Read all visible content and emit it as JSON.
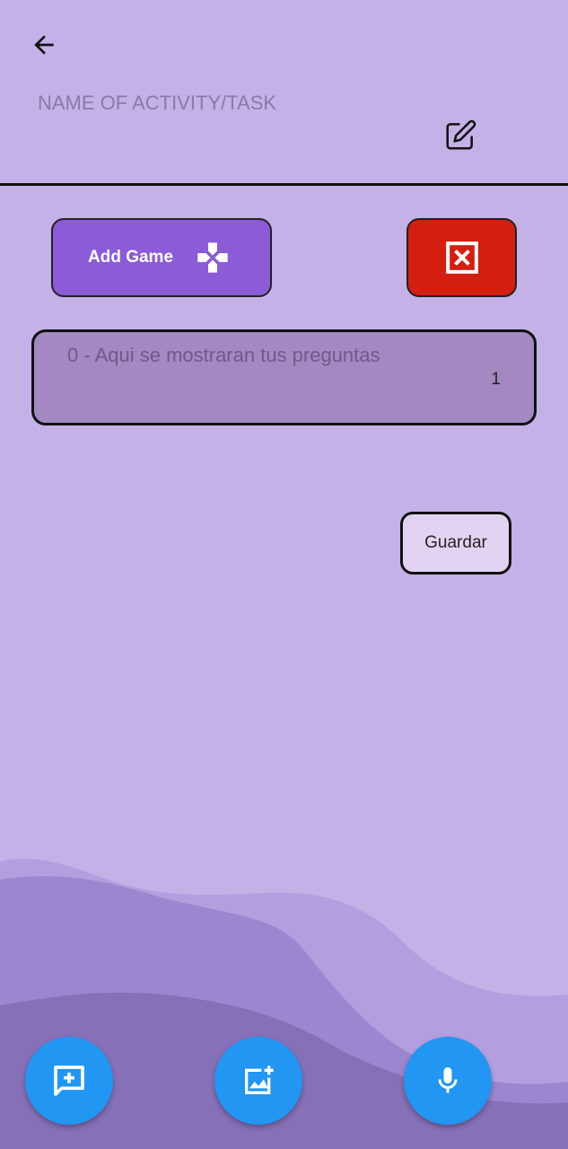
{
  "header": {
    "back_icon": "arrow-back-icon",
    "title_placeholder": "NAME OF ACTIVITY/TASK",
    "edit_icon": "edit-icon"
  },
  "actions": {
    "add_game_label": "Add Game",
    "add_game_icon": "gamepad-icon",
    "close_icon": "close-box-icon"
  },
  "question": {
    "text": "0 - Aqui se mostraran tus preguntas",
    "count": "1"
  },
  "save_label": "Guardar",
  "fabs": [
    {
      "icon": "add-comment-icon"
    },
    {
      "icon": "add-photo-icon"
    },
    {
      "icon": "mic-icon"
    }
  ],
  "colors": {
    "background": "#c3b1e8",
    "add_game": "#8b5bd8",
    "close": "#d31e10",
    "question_box": "#a388c2",
    "save": "#e3d3f2",
    "fab": "#2196f3"
  }
}
